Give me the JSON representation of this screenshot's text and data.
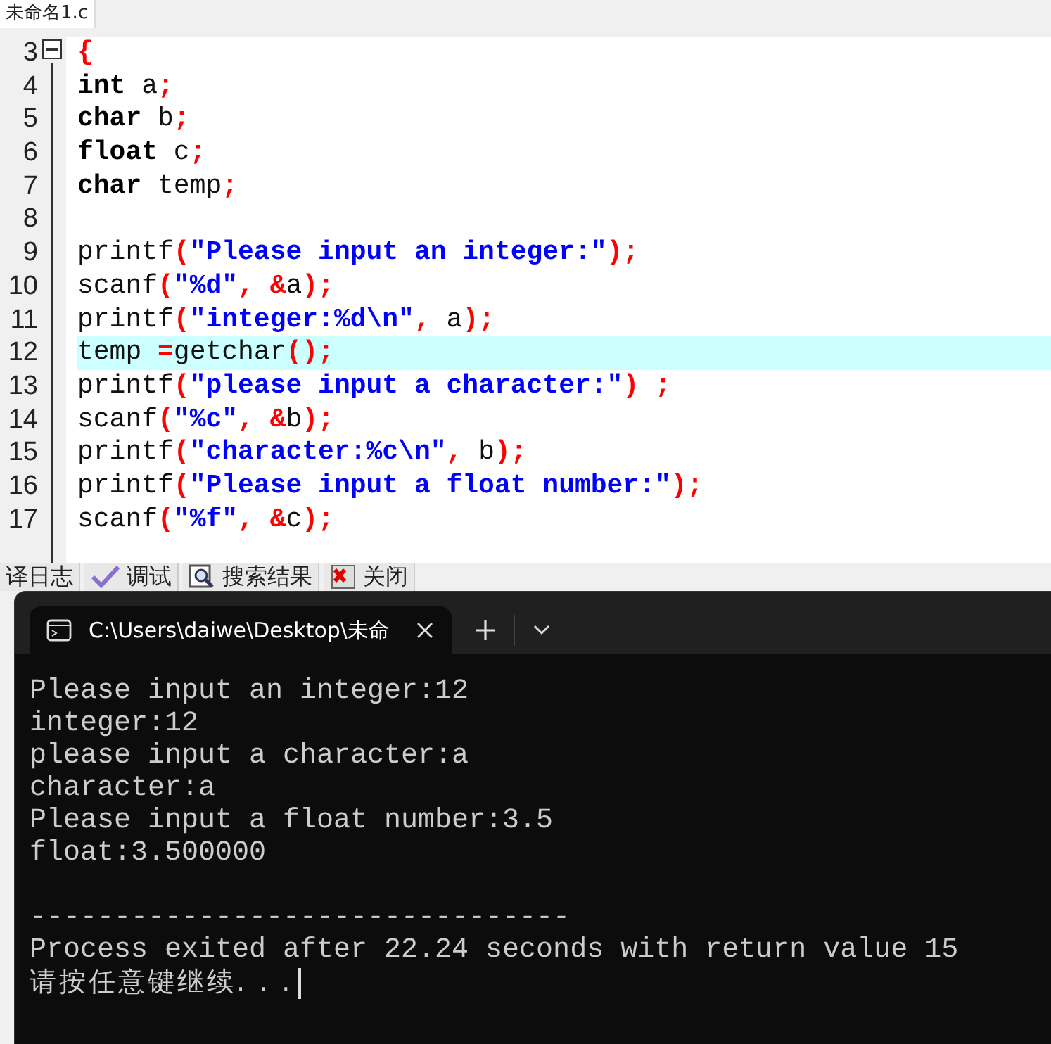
{
  "editor": {
    "file_tab": {
      "label": "未命名1.c",
      "selected": true
    },
    "lines": [
      {
        "number": "3",
        "collapsible": true,
        "highlighted": false,
        "tokens": [
          {
            "kind": "punct",
            "text": "{"
          }
        ]
      },
      {
        "number": "4",
        "collapsible": false,
        "highlighted": false,
        "tokens": [
          {
            "kind": "keyword",
            "text": "int"
          },
          {
            "kind": "plain",
            "text": " a"
          },
          {
            "kind": "punct",
            "text": ";"
          }
        ]
      },
      {
        "number": "5",
        "collapsible": false,
        "highlighted": false,
        "tokens": [
          {
            "kind": "keyword",
            "text": "char"
          },
          {
            "kind": "plain",
            "text": " b"
          },
          {
            "kind": "punct",
            "text": ";"
          }
        ]
      },
      {
        "number": "6",
        "collapsible": false,
        "highlighted": false,
        "tokens": [
          {
            "kind": "keyword",
            "text": "float"
          },
          {
            "kind": "plain",
            "text": " c"
          },
          {
            "kind": "punct",
            "text": ";"
          }
        ]
      },
      {
        "number": "7",
        "collapsible": false,
        "highlighted": false,
        "tokens": [
          {
            "kind": "keyword",
            "text": "char"
          },
          {
            "kind": "plain",
            "text": " temp"
          },
          {
            "kind": "punct",
            "text": ";"
          }
        ]
      },
      {
        "number": "8",
        "collapsible": false,
        "highlighted": false
      },
      {
        "number": "9",
        "collapsible": false,
        "highlighted": false,
        "tokens": [
          {
            "kind": "plain",
            "text": "printf"
          },
          {
            "kind": "punct",
            "text": "("
          },
          {
            "kind": "string",
            "text": "\"Please input an integer:\""
          },
          {
            "kind": "punct",
            "text": ");"
          }
        ]
      },
      {
        "number": "10",
        "collapsible": false,
        "highlighted": false,
        "tokens": [
          {
            "kind": "plain",
            "text": "scanf"
          },
          {
            "kind": "punct",
            "text": "("
          },
          {
            "kind": "string",
            "text": "\"%d\""
          },
          {
            "kind": "punct",
            "text": ", &"
          },
          {
            "kind": "plain",
            "text": "a"
          },
          {
            "kind": "punct",
            "text": ");"
          }
        ]
      },
      {
        "number": "11",
        "collapsible": false,
        "highlighted": false,
        "tokens": [
          {
            "kind": "plain",
            "text": "printf"
          },
          {
            "kind": "punct",
            "text": "("
          },
          {
            "kind": "string",
            "text": "\"integer:%d\\n\""
          },
          {
            "kind": "punct",
            "text": ", "
          },
          {
            "kind": "plain",
            "text": "a"
          },
          {
            "kind": "punct",
            "text": ");"
          }
        ]
      },
      {
        "number": "12",
        "collapsible": false,
        "highlighted": true,
        "tokens": [
          {
            "kind": "plain",
            "text": "temp "
          },
          {
            "kind": "punct",
            "text": "="
          },
          {
            "kind": "plain",
            "text": "getchar"
          },
          {
            "kind": "punct",
            "text": "();"
          }
        ]
      },
      {
        "number": "13",
        "collapsible": false,
        "highlighted": false,
        "tokens": [
          {
            "kind": "plain",
            "text": "printf"
          },
          {
            "kind": "punct",
            "text": "("
          },
          {
            "kind": "string",
            "text": "\"please input a character:\""
          },
          {
            "kind": "punct",
            "text": ") ;"
          }
        ]
      },
      {
        "number": "14",
        "collapsible": false,
        "highlighted": false,
        "tokens": [
          {
            "kind": "plain",
            "text": "scanf"
          },
          {
            "kind": "punct",
            "text": "("
          },
          {
            "kind": "string",
            "text": "\"%c\""
          },
          {
            "kind": "punct",
            "text": ", &"
          },
          {
            "kind": "plain",
            "text": "b"
          },
          {
            "kind": "punct",
            "text": ");"
          }
        ]
      },
      {
        "number": "15",
        "collapsible": false,
        "highlighted": false,
        "tokens": [
          {
            "kind": "plain",
            "text": "printf"
          },
          {
            "kind": "punct",
            "text": "("
          },
          {
            "kind": "string",
            "text": "\"character:%c\\n\""
          },
          {
            "kind": "punct",
            "text": ", "
          },
          {
            "kind": "plain",
            "text": "b"
          },
          {
            "kind": "punct",
            "text": ");"
          }
        ]
      },
      {
        "number": "16",
        "collapsible": false,
        "highlighted": false,
        "tokens": [
          {
            "kind": "plain",
            "text": "printf"
          },
          {
            "kind": "punct",
            "text": "("
          },
          {
            "kind": "string",
            "text": "\"Please input a float number:\""
          },
          {
            "kind": "punct",
            "text": ");"
          }
        ]
      },
      {
        "number": "17",
        "collapsible": false,
        "highlighted": false,
        "tokens": [
          {
            "kind": "plain",
            "text": "scanf"
          },
          {
            "kind": "punct",
            "text": "("
          },
          {
            "kind": "string",
            "text": "\"%f\""
          },
          {
            "kind": "punct",
            "text": ", &"
          },
          {
            "kind": "plain",
            "text": "c"
          },
          {
            "kind": "punct",
            "text": ");"
          }
        ]
      }
    ]
  },
  "bottom_tabs": [
    {
      "label": "译日志"
    },
    {
      "label": "调试"
    },
    {
      "label": "搜索结果"
    },
    {
      "label": "关闭"
    }
  ],
  "terminal": {
    "tab_title": "C:\\Users\\daiwe\\Desktop\\未命",
    "output": [
      "Please input an integer:12",
      "integer:12",
      "please input a character:a",
      "character:a",
      "Please input a float number:3.5",
      "float:3.500000"
    ],
    "separator": "--------------------------------",
    "exit_message": "Process exited after 22.24 seconds with return value 15",
    "prompt": "请按任意键继续. . ."
  }
}
